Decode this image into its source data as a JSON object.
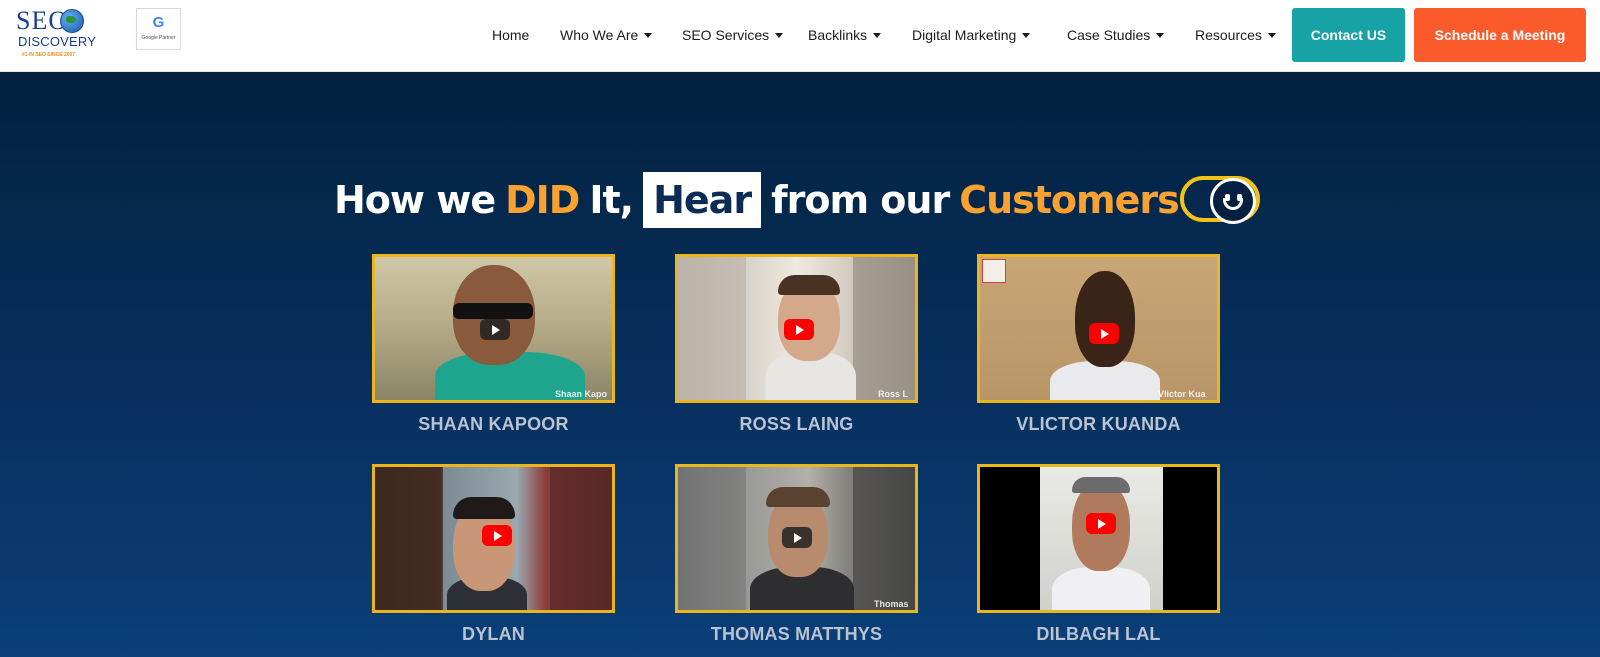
{
  "header": {
    "logo": {
      "text_top": "SEO",
      "text_bottom": "DISCOVERY",
      "tagline": "#1 IN SEO SINCE 2007"
    },
    "google_badge": {
      "letter": "G",
      "label": "Google Partner"
    },
    "nav": [
      {
        "label": "Home",
        "dropdown": false
      },
      {
        "label": "Who We Are",
        "dropdown": true
      },
      {
        "label": "SEO Services",
        "dropdown": true
      },
      {
        "label": "Backlinks",
        "dropdown": true
      },
      {
        "label": "Digital Marketing",
        "dropdown": true
      },
      {
        "label": "Case Studies",
        "dropdown": true
      },
      {
        "label": "Resources",
        "dropdown": true
      }
    ],
    "contact_label": "Contact US",
    "meeting_label": "Schedule a Meeting"
  },
  "headline": {
    "part1": "How we",
    "part2": "DID",
    "part3": "It,",
    "part4": "Hear",
    "part5": "from our",
    "part6": "Customers"
  },
  "testimonials": [
    {
      "name": "SHAAN KAPOOR",
      "caption": "Shaan Kapo",
      "play_style": "dark"
    },
    {
      "name": "ROSS LAING",
      "caption": "Ross L",
      "play_style": "red"
    },
    {
      "name": "VLICTOR KUANDA",
      "caption": "Vlictor Kua",
      "play_style": "red"
    },
    {
      "name": "DYLAN",
      "caption": "",
      "play_style": "red"
    },
    {
      "name": "THOMAS MATTHYS",
      "caption": "Thomas M",
      "play_style": "dark"
    },
    {
      "name": "DILBAGH LAL",
      "caption": "",
      "play_style": "red"
    }
  ],
  "colors": {
    "accent_orange": "#f9a131",
    "contact_button": "#17a2a6",
    "meeting_button": "#fb5a2b",
    "thumb_border": "#eab61c",
    "background": "#07305f"
  },
  "icons": [
    "globe-icon",
    "google-g-icon",
    "chevron-down-icon",
    "smiley-toggle-icon",
    "play-icon"
  ]
}
